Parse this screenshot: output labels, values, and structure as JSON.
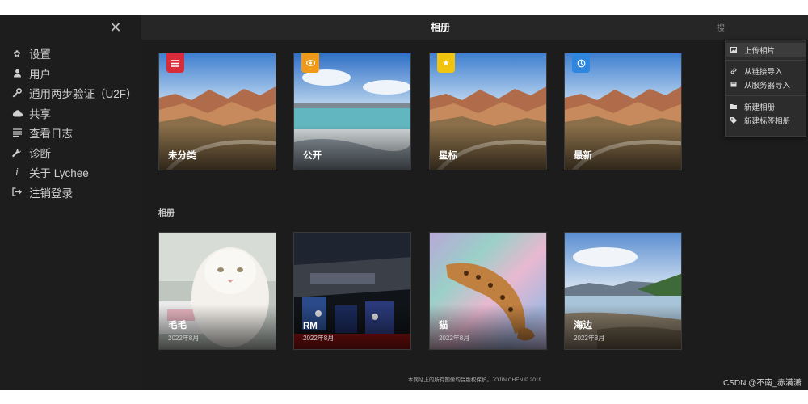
{
  "sidebar": {
    "items": [
      {
        "icon": "gear-icon",
        "label": "设置"
      },
      {
        "icon": "user-icon",
        "label": "用户"
      },
      {
        "icon": "key-icon",
        "label": "通用两步验证（U2F）"
      },
      {
        "icon": "cloud-icon",
        "label": "共享"
      },
      {
        "icon": "list-icon",
        "label": "查看日志"
      },
      {
        "icon": "wrench-icon",
        "label": "诊断"
      },
      {
        "icon": "info-icon",
        "label": "关于 Lychee"
      },
      {
        "icon": "sign-out-icon",
        "label": "注销登录"
      }
    ]
  },
  "header": {
    "title": "相册",
    "search_hint": "搜"
  },
  "smart_albums": [
    {
      "title": "未分类",
      "badge_icon": "list-icon",
      "badge_color": "#d92c3a"
    },
    {
      "title": "公开",
      "badge_icon": "eye-icon",
      "badge_color": "#f09a1b"
    },
    {
      "title": "星标",
      "badge_icon": "star-icon",
      "badge_color": "#f1c40f"
    },
    {
      "title": "最新",
      "badge_icon": "clock-icon",
      "badge_color": "#2e86de"
    }
  ],
  "albums_section_label": "相册",
  "albums": [
    {
      "title": "毛毛",
      "date": "2022年8月"
    },
    {
      "title": "RM",
      "date": "2022年8月"
    },
    {
      "title": "猫",
      "date": "2022年8月"
    },
    {
      "title": "海边",
      "date": "2022年8月"
    }
  ],
  "footer": "本网站上的所有图像均受版权保护。JOJIN CHEN © 2019",
  "dropdown": {
    "items": [
      {
        "icon": "image-icon",
        "label": "上传相片"
      },
      {
        "icon": "link-icon",
        "label": "从链接导入"
      },
      {
        "icon": "server-icon",
        "label": "从服务器导入"
      },
      {
        "icon": "folder-icon",
        "label": "新建相册"
      },
      {
        "icon": "tags-icon",
        "label": "新建标签相册"
      }
    ]
  },
  "watermark": "CSDN @不南_赤满潇"
}
